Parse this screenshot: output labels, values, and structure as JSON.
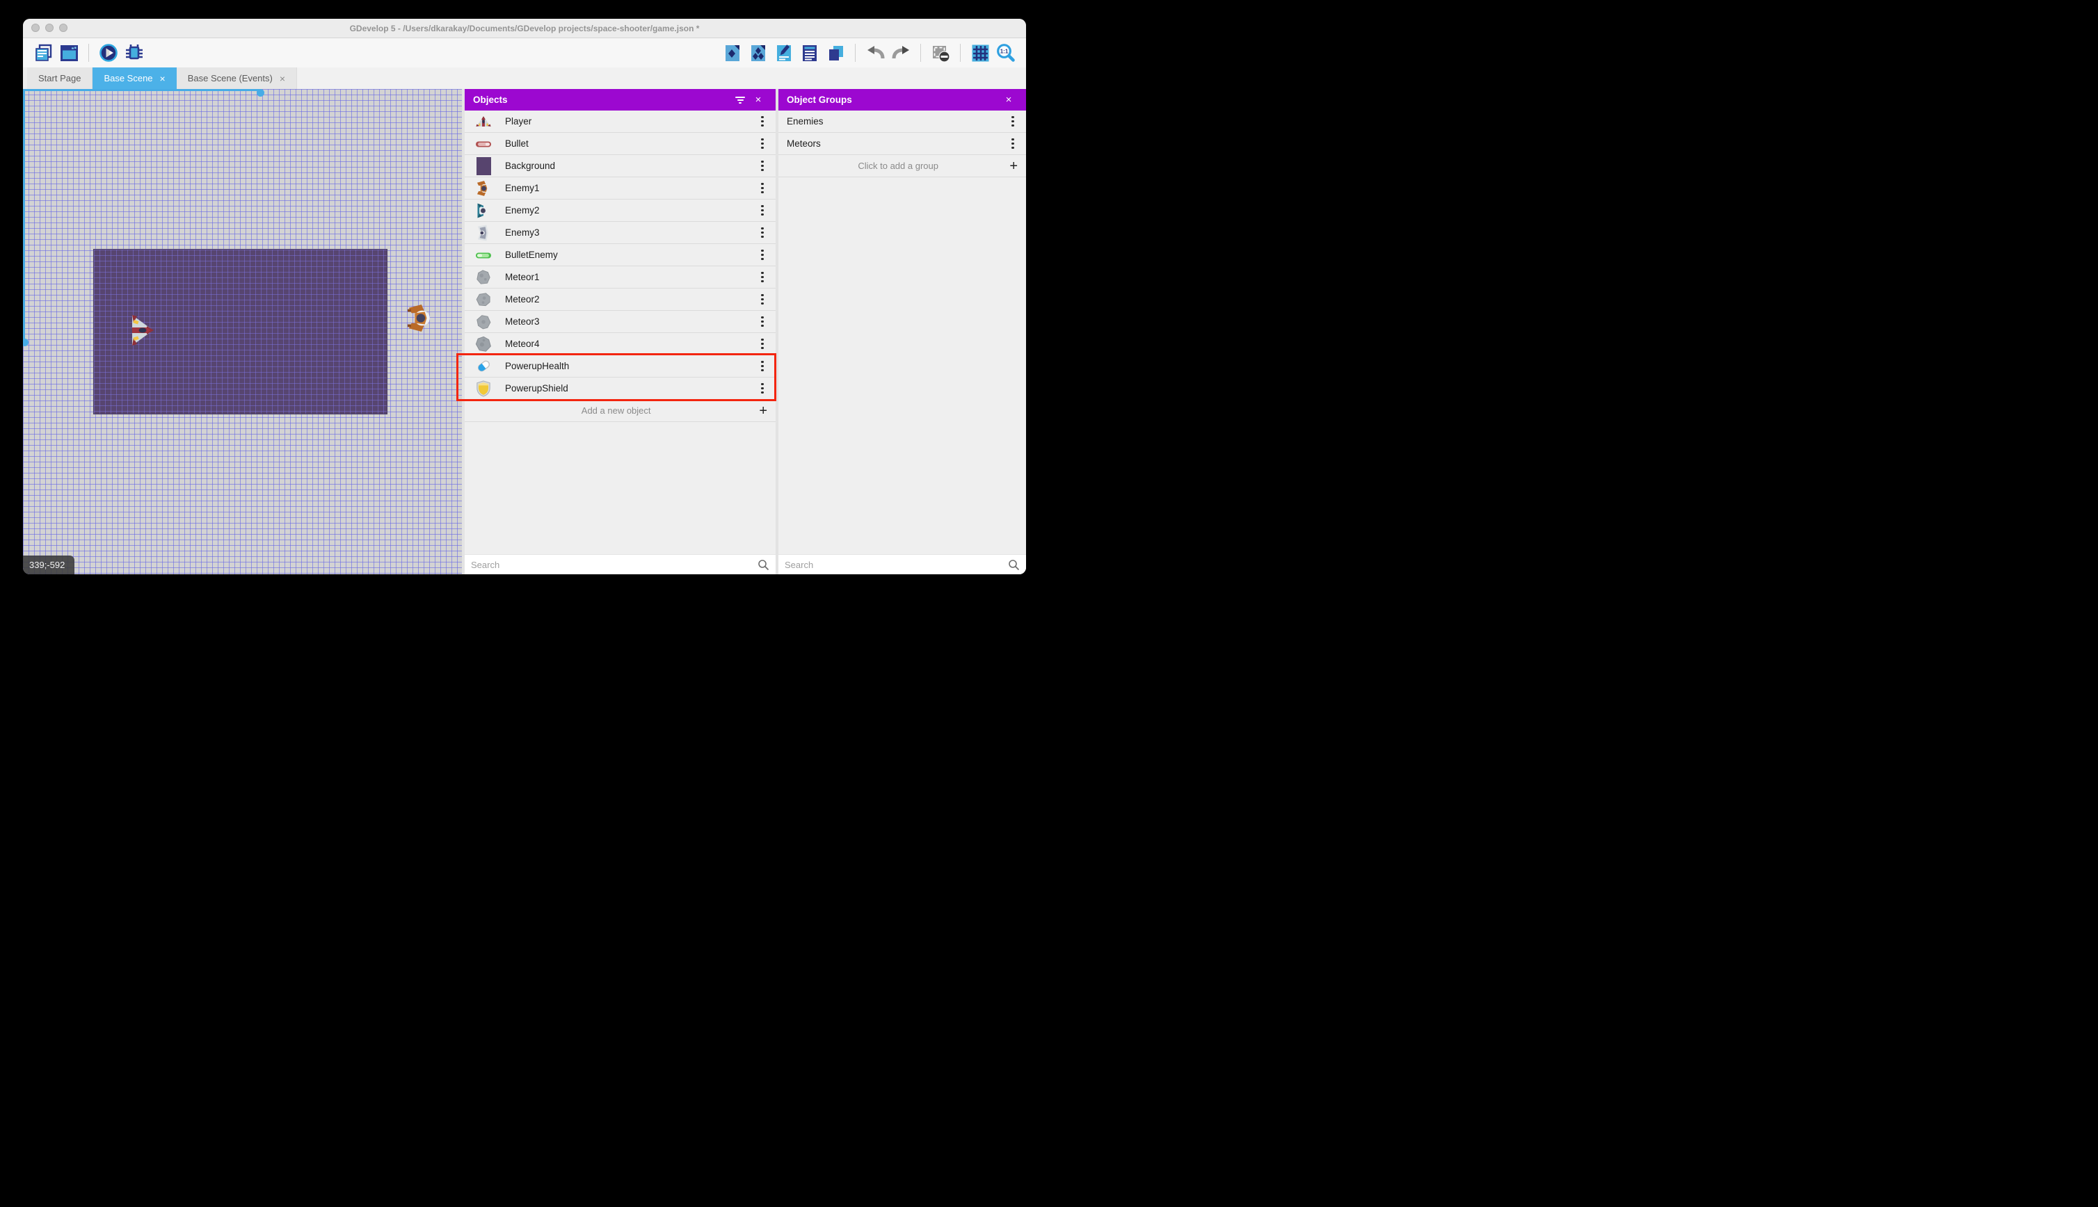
{
  "window": {
    "title": "GDevelop 5 - /Users/dkarakay/Documents/GDevelop projects/space-shooter/game.json *"
  },
  "icons": {
    "close": "×",
    "plus": "+",
    "kebab": "⋮"
  },
  "toolbar": {
    "zoom_ratio": "1:1"
  },
  "tabs": [
    {
      "label": "Start Page",
      "active": false,
      "closable": false
    },
    {
      "label": "Base Scene",
      "active": true,
      "closable": true
    },
    {
      "label": "Base Scene (Events)",
      "active": false,
      "closable": true
    }
  ],
  "scene": {
    "coordinates": "339;-592"
  },
  "objects_panel": {
    "title": "Objects",
    "items": [
      {
        "name": "Player",
        "icon": "player-ship"
      },
      {
        "name": "Bullet",
        "icon": "red-bullet"
      },
      {
        "name": "Background",
        "icon": "purple-swatch"
      },
      {
        "name": "Enemy1",
        "icon": "enemy-ship-orange"
      },
      {
        "name": "Enemy2",
        "icon": "enemy-ship-teal"
      },
      {
        "name": "Enemy3",
        "icon": "enemy-ship-gray"
      },
      {
        "name": "BulletEnemy",
        "icon": "green-bullet"
      },
      {
        "name": "Meteor1",
        "icon": "meteor"
      },
      {
        "name": "Meteor2",
        "icon": "meteor"
      },
      {
        "name": "Meteor3",
        "icon": "meteor"
      },
      {
        "name": "Meteor4",
        "icon": "meteor"
      },
      {
        "name": "PowerupHealth",
        "icon": "health-pill"
      },
      {
        "name": "PowerupShield",
        "icon": "shield"
      }
    ],
    "highlighted_items": [
      "PowerupHealth",
      "PowerupShield"
    ],
    "add_label": "Add a new object",
    "search_placeholder": "Search"
  },
  "object_groups_panel": {
    "title": "Object Groups",
    "groups": [
      {
        "name": "Enemies"
      },
      {
        "name": "Meteors"
      }
    ],
    "add_label": "Click to add a group",
    "search_placeholder": "Search"
  },
  "colors": {
    "panel_header": "#9c08d0",
    "active_tab": "#4cb1e8",
    "highlight_border": "#f3250f",
    "scene_background_object": "#574570",
    "accent_blue": "#45aede",
    "accent_navy": "#2b3a8f"
  }
}
